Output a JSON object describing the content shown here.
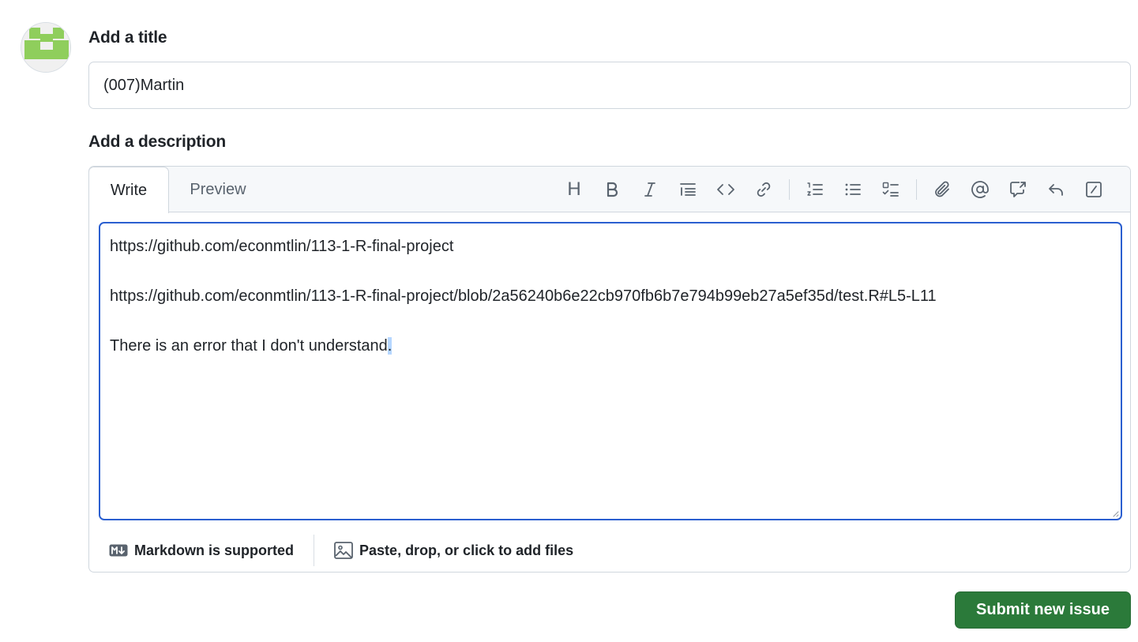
{
  "title_section": {
    "label": "Add a title",
    "value": "(007)Martin"
  },
  "description_section": {
    "label": "Add a description",
    "tabs": {
      "write": "Write",
      "preview": "Preview"
    },
    "toolbar": {
      "heading": "H",
      "icons": [
        "heading-icon",
        "bold-icon",
        "italic-icon",
        "quote-icon",
        "code-icon",
        "link-icon",
        "numbered-list-icon",
        "unordered-list-icon",
        "task-list-icon",
        "attach-icon",
        "mention-icon",
        "cross-reference-icon",
        "reply-icon",
        "slash-commands-icon"
      ]
    },
    "body": {
      "line1": "https://github.com/econmtlin/113-1-R-final-project",
      "line2": "https://github.com/econmtlin/113-1-R-final-project/blob/2a56240b6e22cb970fb6b7e794b99eb27a5ef35d/test.R#L5-L11",
      "line3_main": "There is an error that I don't understand",
      "line3_selected": "."
    },
    "footer": {
      "markdown": "Markdown is supported",
      "files": "Paste, drop, or click to add files"
    }
  },
  "submit_button": "Submit new issue",
  "colors": {
    "accent_focus": "#2b5fd0",
    "submit_green": "#2b7a3a",
    "avatar_green": "#8fce5c"
  }
}
